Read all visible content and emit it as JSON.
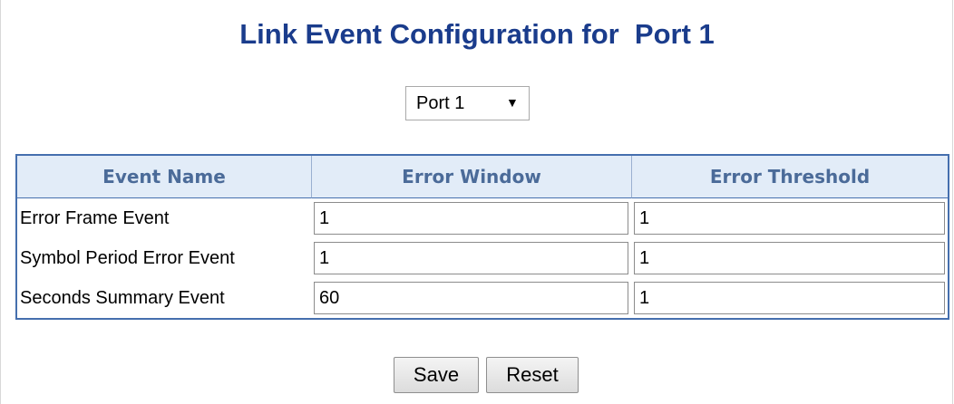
{
  "page": {
    "title": "Link Event Configuration for  Port 1"
  },
  "port_select": {
    "selected": "Port 1",
    "arrow": "▼"
  },
  "table": {
    "headers": [
      "Event Name",
      "Error Window",
      "Error Threshold"
    ],
    "rows": [
      {
        "name": "Error Frame Event",
        "window": "1",
        "threshold": "1"
      },
      {
        "name": "Symbol Period Error Event",
        "window": "1",
        "threshold": "1"
      },
      {
        "name": "Seconds Summary Event",
        "window": "60",
        "threshold": "1"
      }
    ]
  },
  "buttons": {
    "save": "Save",
    "reset": "Reset"
  },
  "colors": {
    "title": "#1a3c8c",
    "header_bg": "#e2ecf8",
    "header_text": "#4b6b99",
    "table_border": "#456fae"
  }
}
